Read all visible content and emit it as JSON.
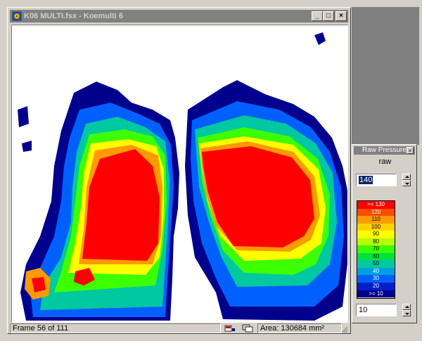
{
  "main_window": {
    "title": "K06 MULTI.fsx - Koemulti 6",
    "buttons": {
      "minimize": "_",
      "maximize": "□",
      "close": "×"
    }
  },
  "status": {
    "frame": "Frame 56 of 111",
    "area": "Area: 130684 mm²"
  },
  "legend_window": {
    "title": "Raw Pressure",
    "close": "×",
    "mode": "raw",
    "max_value": "140",
    "min_value": "10",
    "scale": [
      {
        "label": ">= 130",
        "color": "#ff0000"
      },
      {
        "label": "120",
        "color": "#ff4a00"
      },
      {
        "label": "110",
        "color": "#ff9a00"
      },
      {
        "label": "100",
        "color": "#ffd200"
      },
      {
        "label": "90",
        "color": "#ffff00"
      },
      {
        "label": "80",
        "color": "#b6ff00"
      },
      {
        "label": "70",
        "color": "#3cff00"
      },
      {
        "label": "60",
        "color": "#00e040"
      },
      {
        "label": "50",
        "color": "#00c8a0"
      },
      {
        "label": "40",
        "color": "#00a0e0"
      },
      {
        "label": "30",
        "color": "#0060ff"
      },
      {
        "label": "20",
        "color": "#0020c8"
      },
      {
        "label": ">= 10",
        "color": "#00008c"
      }
    ]
  },
  "colors": {
    "title_inactive": "#808080",
    "window_face": "#d4d0c8",
    "mdi_background": "#808080"
  }
}
